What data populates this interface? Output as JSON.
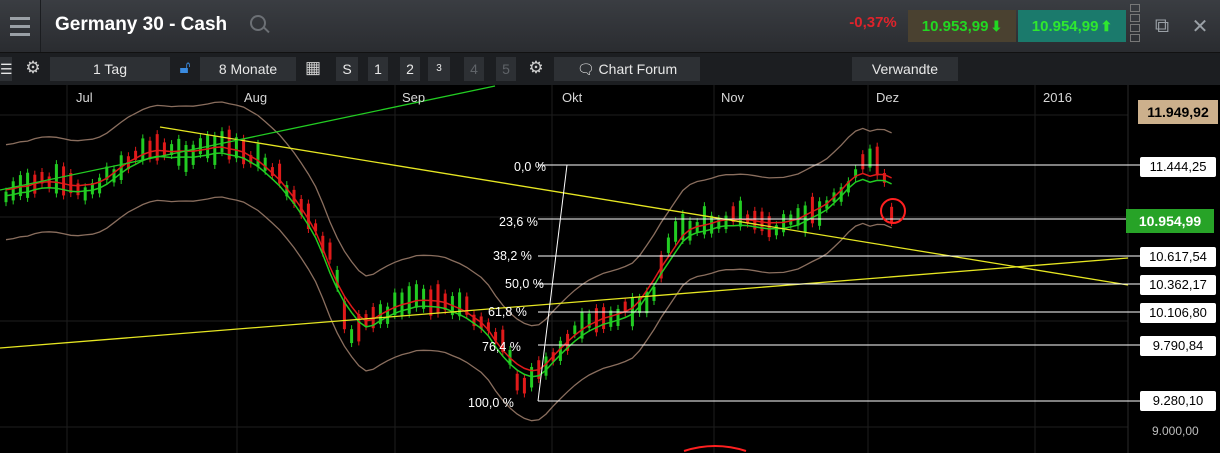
{
  "window": {
    "title": "Germany 30 - Cash",
    "change": "-0,37%",
    "bid": "10.953,99",
    "ask": "10.954,99"
  },
  "toolbar": {
    "interval": "1 Tag",
    "range": "8 Monate",
    "chart_types": [
      "S",
      "1",
      "2",
      "3",
      "4",
      "5"
    ],
    "chart_forum": "Chart Forum",
    "related": "Verwandte"
  },
  "chart": {
    "months": [
      "Jul",
      "Aug",
      "Sep",
      "Okt",
      "Nov",
      "Dez",
      "2016"
    ],
    "fib_levels": [
      {
        "label": "0,0 %",
        "price": "11.444,25"
      },
      {
        "label": "23,6 %",
        "price": "10.954,99"
      },
      {
        "label": "38,2 %",
        "price": "10.617,54"
      },
      {
        "label": "50,0 %",
        "price": "10.362,17"
      },
      {
        "label": "61,8 %",
        "price": "10.106,80"
      },
      {
        "label": "76,4 %",
        "price": "9.790,84"
      },
      {
        "label": "100,0 %",
        "price": "9.280,10"
      }
    ],
    "top_price": "11.949,92",
    "current_price": "10.954,99",
    "bottom_price": "9.000,00",
    "colors": {
      "up": "#22cc22",
      "down": "#e01a1a",
      "fib": "#ffffff",
      "trend": "#e6e622",
      "bollinger": "#8a6e5e"
    }
  }
}
